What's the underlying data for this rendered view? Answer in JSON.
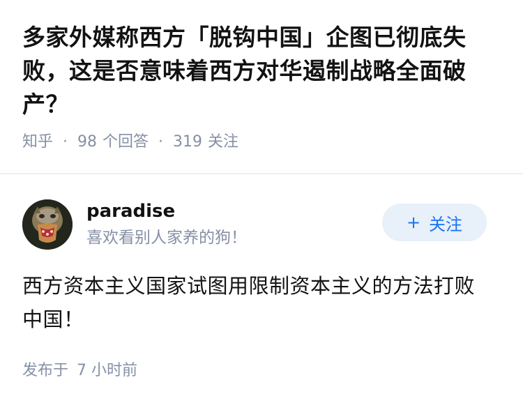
{
  "question": {
    "title": "多家外媒称西方「脱钩中国」企图已彻底失败，这是否意味着西方对华遏制战略全面破产？",
    "source": "知乎",
    "answer_count": "98",
    "answer_label": "个回答",
    "follow_count": "319",
    "follow_label": "关注"
  },
  "answer": {
    "author": {
      "name": "paradise",
      "bio": "喜欢看别人家养的狗！",
      "avatar_icon": "avatar-icon"
    },
    "follow_button": {
      "plus": "+",
      "label": "关注"
    },
    "content": "西方资本主义国家试图用限制资本主义的方法打败中国！",
    "time_prefix": "发布于",
    "time_value": "7 小时前"
  },
  "colors": {
    "title": "#121212",
    "meta": "#8590a6",
    "accent": "#1772f6",
    "follow_bg": "#e8f0fa"
  }
}
